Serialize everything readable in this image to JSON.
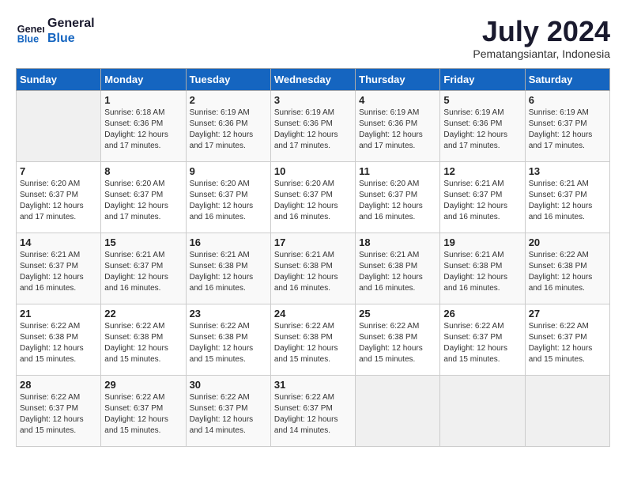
{
  "header": {
    "logo_line1": "General",
    "logo_line2": "Blue",
    "month_year": "July 2024",
    "location": "Pematangsiantar, Indonesia"
  },
  "days_of_week": [
    "Sunday",
    "Monday",
    "Tuesday",
    "Wednesday",
    "Thursday",
    "Friday",
    "Saturday"
  ],
  "weeks": [
    [
      {
        "day": "",
        "info": ""
      },
      {
        "day": "1",
        "info": "Sunrise: 6:18 AM\nSunset: 6:36 PM\nDaylight: 12 hours\nand 17 minutes."
      },
      {
        "day": "2",
        "info": "Sunrise: 6:19 AM\nSunset: 6:36 PM\nDaylight: 12 hours\nand 17 minutes."
      },
      {
        "day": "3",
        "info": "Sunrise: 6:19 AM\nSunset: 6:36 PM\nDaylight: 12 hours\nand 17 minutes."
      },
      {
        "day": "4",
        "info": "Sunrise: 6:19 AM\nSunset: 6:36 PM\nDaylight: 12 hours\nand 17 minutes."
      },
      {
        "day": "5",
        "info": "Sunrise: 6:19 AM\nSunset: 6:36 PM\nDaylight: 12 hours\nand 17 minutes."
      },
      {
        "day": "6",
        "info": "Sunrise: 6:19 AM\nSunset: 6:37 PM\nDaylight: 12 hours\nand 17 minutes."
      }
    ],
    [
      {
        "day": "7",
        "info": "Sunrise: 6:20 AM\nSunset: 6:37 PM\nDaylight: 12 hours\nand 17 minutes."
      },
      {
        "day": "8",
        "info": "Sunrise: 6:20 AM\nSunset: 6:37 PM\nDaylight: 12 hours\nand 17 minutes."
      },
      {
        "day": "9",
        "info": "Sunrise: 6:20 AM\nSunset: 6:37 PM\nDaylight: 12 hours\nand 16 minutes."
      },
      {
        "day": "10",
        "info": "Sunrise: 6:20 AM\nSunset: 6:37 PM\nDaylight: 12 hours\nand 16 minutes."
      },
      {
        "day": "11",
        "info": "Sunrise: 6:20 AM\nSunset: 6:37 PM\nDaylight: 12 hours\nand 16 minutes."
      },
      {
        "day": "12",
        "info": "Sunrise: 6:21 AM\nSunset: 6:37 PM\nDaylight: 12 hours\nand 16 minutes."
      },
      {
        "day": "13",
        "info": "Sunrise: 6:21 AM\nSunset: 6:37 PM\nDaylight: 12 hours\nand 16 minutes."
      }
    ],
    [
      {
        "day": "14",
        "info": "Sunrise: 6:21 AM\nSunset: 6:37 PM\nDaylight: 12 hours\nand 16 minutes."
      },
      {
        "day": "15",
        "info": "Sunrise: 6:21 AM\nSunset: 6:37 PM\nDaylight: 12 hours\nand 16 minutes."
      },
      {
        "day": "16",
        "info": "Sunrise: 6:21 AM\nSunset: 6:38 PM\nDaylight: 12 hours\nand 16 minutes."
      },
      {
        "day": "17",
        "info": "Sunrise: 6:21 AM\nSunset: 6:38 PM\nDaylight: 12 hours\nand 16 minutes."
      },
      {
        "day": "18",
        "info": "Sunrise: 6:21 AM\nSunset: 6:38 PM\nDaylight: 12 hours\nand 16 minutes."
      },
      {
        "day": "19",
        "info": "Sunrise: 6:21 AM\nSunset: 6:38 PM\nDaylight: 12 hours\nand 16 minutes."
      },
      {
        "day": "20",
        "info": "Sunrise: 6:22 AM\nSunset: 6:38 PM\nDaylight: 12 hours\nand 16 minutes."
      }
    ],
    [
      {
        "day": "21",
        "info": "Sunrise: 6:22 AM\nSunset: 6:38 PM\nDaylight: 12 hours\nand 15 minutes."
      },
      {
        "day": "22",
        "info": "Sunrise: 6:22 AM\nSunset: 6:38 PM\nDaylight: 12 hours\nand 15 minutes."
      },
      {
        "day": "23",
        "info": "Sunrise: 6:22 AM\nSunset: 6:38 PM\nDaylight: 12 hours\nand 15 minutes."
      },
      {
        "day": "24",
        "info": "Sunrise: 6:22 AM\nSunset: 6:38 PM\nDaylight: 12 hours\nand 15 minutes."
      },
      {
        "day": "25",
        "info": "Sunrise: 6:22 AM\nSunset: 6:38 PM\nDaylight: 12 hours\nand 15 minutes."
      },
      {
        "day": "26",
        "info": "Sunrise: 6:22 AM\nSunset: 6:37 PM\nDaylight: 12 hours\nand 15 minutes."
      },
      {
        "day": "27",
        "info": "Sunrise: 6:22 AM\nSunset: 6:37 PM\nDaylight: 12 hours\nand 15 minutes."
      }
    ],
    [
      {
        "day": "28",
        "info": "Sunrise: 6:22 AM\nSunset: 6:37 PM\nDaylight: 12 hours\nand 15 minutes."
      },
      {
        "day": "29",
        "info": "Sunrise: 6:22 AM\nSunset: 6:37 PM\nDaylight: 12 hours\nand 15 minutes."
      },
      {
        "day": "30",
        "info": "Sunrise: 6:22 AM\nSunset: 6:37 PM\nDaylight: 12 hours\nand 14 minutes."
      },
      {
        "day": "31",
        "info": "Sunrise: 6:22 AM\nSunset: 6:37 PM\nDaylight: 12 hours\nand 14 minutes."
      },
      {
        "day": "",
        "info": ""
      },
      {
        "day": "",
        "info": ""
      },
      {
        "day": "",
        "info": ""
      }
    ]
  ]
}
